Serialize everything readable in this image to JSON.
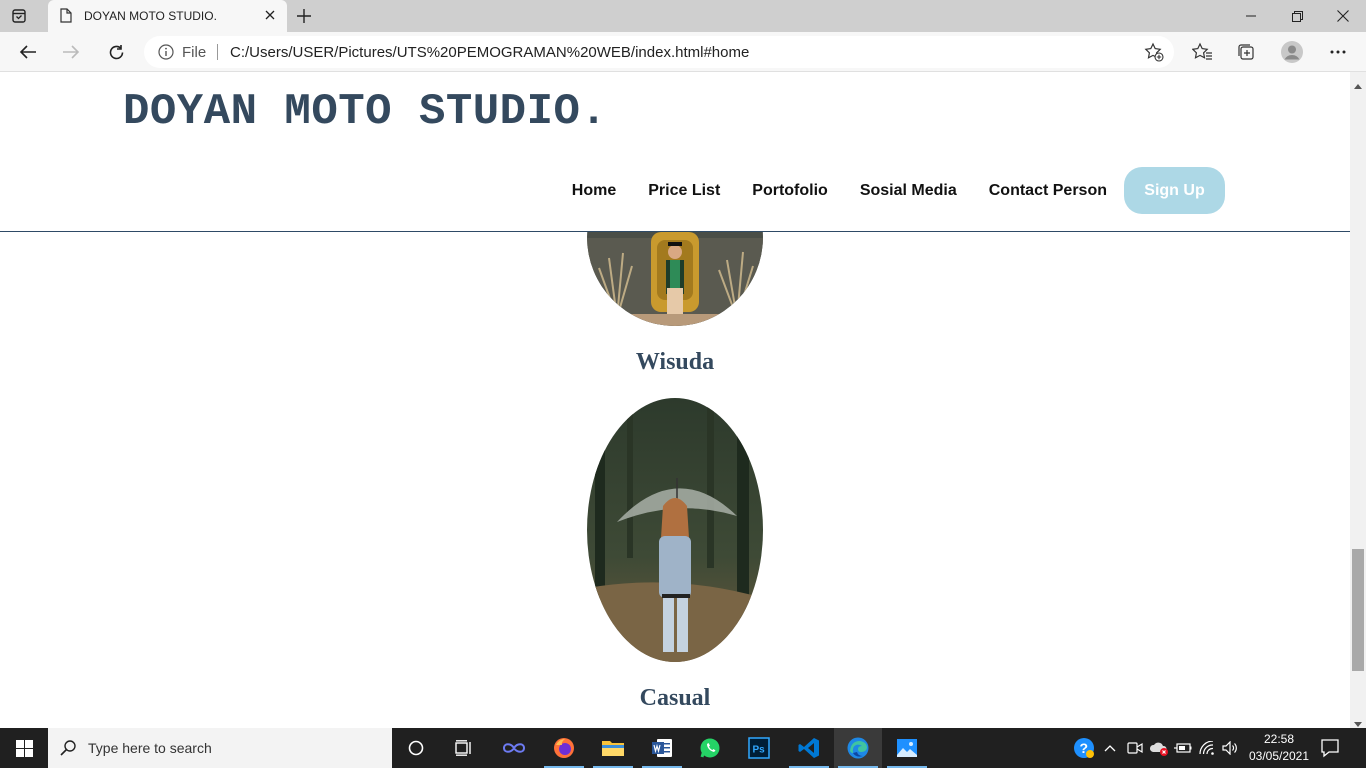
{
  "browser": {
    "tab_title": "DOYAN MOTO STUDIO.",
    "address": {
      "scheme_label": "File",
      "url": "C:/Users/USER/Pictures/UTS%20PEMOGRAMAN%20WEB/index.html#home"
    }
  },
  "site": {
    "logo": "DOYAN MOTO STUDIO.",
    "nav": [
      "Home",
      "Price List",
      "Portofolio",
      "Sosial Media",
      "Contact Person"
    ],
    "signup_label": "Sign Up",
    "colors": {
      "heading": "#34495e",
      "signup_bg": "#add8e6",
      "divider": "#2e4a66"
    }
  },
  "portfolio": {
    "items": [
      {
        "caption": "Wisuda"
      },
      {
        "caption": "Casual"
      }
    ]
  },
  "taskbar": {
    "search_placeholder": "Type here to search",
    "apps": [
      "cortana-icon",
      "task-view-icon",
      "infinity-app-icon",
      "firefox-icon",
      "file-explorer-icon",
      "word-icon",
      "whatsapp-icon",
      "photoshop-icon",
      "vscode-icon",
      "edge-icon",
      "photos-icon"
    ],
    "clock": {
      "time": "22:58",
      "date": "03/05/2021"
    }
  }
}
